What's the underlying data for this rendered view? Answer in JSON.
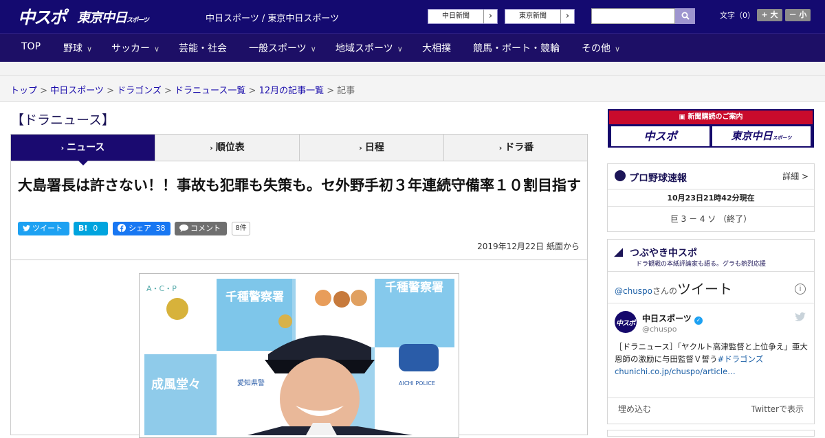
{
  "header": {
    "logo_main": "中スポ",
    "logo_sub": "東京中日",
    "logo_sub_small": "スポーツ",
    "site_links": "中日スポーツ / 東京中日スポーツ",
    "btn_chunichi": "中日新聞",
    "btn_tokyo": "東京新聞",
    "arrow": "›",
    "font_label": "文字（0）",
    "font_up": "+ 大",
    "font_down": "－ 小"
  },
  "nav": [
    "TOP",
    "野球",
    "サッカー",
    "芸能・社会",
    "一般スポーツ",
    "地域スポーツ",
    "大相撲",
    "競馬・ボート・競輪",
    "その他"
  ],
  "breadcrumb": [
    "トップ",
    "中日スポーツ",
    "ドラゴンズ",
    "ドラニュース一覧",
    "12月の記事一覧",
    "記事"
  ],
  "section_title": "【ドラニュース】",
  "tabs": [
    "ニュース",
    "順位表",
    "日程",
    "ドラ番"
  ],
  "article": {
    "headline": "大島署長は許さない！！事故も犯罪も失策も。セ外野手初３年連続守備率１０割目指す",
    "tweet_label": "ツイート",
    "hatena_label": "B!",
    "hatena_count": "0",
    "share_label": "シェア",
    "share_count": "38",
    "comment_label": "コメント",
    "comment_count": "8件",
    "date": "2019年12月22日 紙面から"
  },
  "photo": {
    "text_a": "千種警察署",
    "text_b": "千種警察署",
    "text_c": "成風堂々",
    "text_d": "愛知県警",
    "text_e": "AICHI POLICE",
    "letters": "A・C・P"
  },
  "sidebar": {
    "ad_title": "新聞購読のご案内",
    "ad_left": "中スポ",
    "ad_right": "東京中日",
    "ad_right_small": "スポーツ",
    "score_title": "プロ野球速報",
    "score_detail": "詳細 >",
    "score_time": "10月23日21時42分現在",
    "score_line": "巨 3 － 4 ソ （終了）",
    "tw_title": "つぶやき中スポ",
    "tw_sub": "ドラ観戦の本紙評論家も語る。グラも熱烈応援",
    "tw_handle": "@chuspo",
    "tw_handle_suffix": "さんの",
    "tw_heading": "ツイート",
    "tw_user": "中日スポーツ",
    "tw_user_handle": "@chuspo",
    "tw_text1": "［ドラニュース］「ヤクルト高津監督と上位争え」亜大恩師の激励に与田監督Ｖ誓う",
    "tw_hashtag": "#ドラゴンズ",
    "tw_link": "chunichi.co.jp/chuspo/article…",
    "tw_embed": "埋め込む",
    "tw_view": "Twitterで表示",
    "info": "i"
  },
  "colors": {
    "header_bg": "#140a70",
    "nav_bg": "#1d0f66",
    "tab_active": "#1a0a70",
    "ad_red": "#c90b2c",
    "twitter_blue": "#1da1f2",
    "facebook_blue": "#1877f2",
    "hatena_blue": "#00a4de"
  }
}
